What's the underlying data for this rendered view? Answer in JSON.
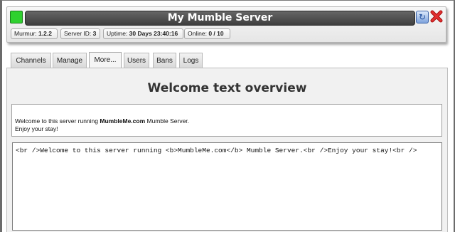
{
  "header": {
    "title": "My Mumble Server",
    "status_color": "#2fd12f",
    "refresh_icon": "refresh-icon",
    "close_icon": "close-icon",
    "stats": {
      "murmur_label": "Murmur:",
      "murmur_value": "1.2.2",
      "server_id_label": "Server ID:",
      "server_id_value": "3",
      "uptime_label": "Uptime:",
      "uptime_value": "30 Days 23:40:16",
      "online_label": "Online:",
      "online_value": "0 / 10"
    }
  },
  "tabs": [
    {
      "label": "Channels"
    },
    {
      "label": "Manage"
    },
    {
      "label": "More..."
    },
    {
      "label": "Users"
    },
    {
      "label": "Bans"
    },
    {
      "label": "Logs"
    }
  ],
  "active_tab": "More...",
  "content": {
    "title": "Welcome text overview",
    "preview": {
      "line1_before": "Welcome to this server running ",
      "line1_bold": "MumbleMe.com",
      "line1_after": " Mumble Server.",
      "line2": "Enjoy your stay!"
    },
    "source_text": "<br />Welcome to this server running <b>MumbleMe.com</b> Mumble Server.<br />Enjoy your stay!<br />"
  }
}
